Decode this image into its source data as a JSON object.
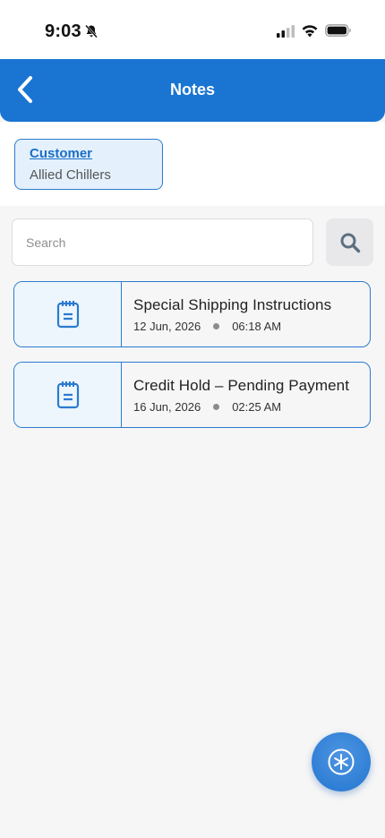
{
  "status_bar": {
    "time": "9:03"
  },
  "header": {
    "title": "Notes"
  },
  "context": {
    "label": "Customer",
    "value": "Allied Chillers"
  },
  "search": {
    "placeholder": "Search",
    "value": ""
  },
  "notes": [
    {
      "title": "Special Shipping Instructions",
      "date": "12 Jun, 2026",
      "time": "06:18 AM"
    },
    {
      "title": "Credit Hold – Pending Payment",
      "date": "16 Jun, 2026",
      "time": "02:25 AM"
    }
  ],
  "icons": {
    "back": "chevron-left-icon",
    "bell": "bell-slash-icon",
    "search": "search-icon",
    "note": "notepad-icon",
    "fab": "asterisk-icon"
  },
  "colors": {
    "accent": "#1a75d2",
    "border": "#2b7bcf",
    "card_tint": "#e4f0fc"
  }
}
